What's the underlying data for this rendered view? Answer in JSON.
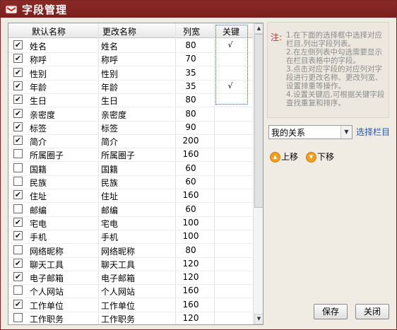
{
  "window": {
    "title": "字段管理"
  },
  "grid": {
    "columns": {
      "default_name": "默认名称",
      "new_name": "更改名称",
      "width": "列宽",
      "key": "关键"
    },
    "rows": [
      {
        "checked": true,
        "default": "姓名",
        "new": "姓名",
        "width": "80",
        "key": "√"
      },
      {
        "checked": true,
        "default": "称呼",
        "new": "称呼",
        "width": "70",
        "key": ""
      },
      {
        "checked": true,
        "default": "性别",
        "new": "性别",
        "width": "35",
        "key": ""
      },
      {
        "checked": true,
        "default": "年龄",
        "new": "年龄",
        "width": "35",
        "key": "√"
      },
      {
        "checked": true,
        "default": "生日",
        "new": "生日",
        "width": "80",
        "key": ""
      },
      {
        "checked": true,
        "default": "亲密度",
        "new": "亲密度",
        "width": "80",
        "key": ""
      },
      {
        "checked": true,
        "default": "标签",
        "new": "标签",
        "width": "90",
        "key": ""
      },
      {
        "checked": true,
        "default": "简介",
        "new": "简介",
        "width": "200",
        "key": ""
      },
      {
        "checked": false,
        "default": "所属圈子",
        "new": "所属圈子",
        "width": "160",
        "key": ""
      },
      {
        "checked": false,
        "default": "国籍",
        "new": "国籍",
        "width": "60",
        "key": ""
      },
      {
        "checked": false,
        "default": "民族",
        "new": "民族",
        "width": "60",
        "key": ""
      },
      {
        "checked": true,
        "default": "住址",
        "new": "住址",
        "width": "160",
        "key": ""
      },
      {
        "checked": false,
        "default": "邮编",
        "new": "邮编",
        "width": "60",
        "key": ""
      },
      {
        "checked": true,
        "default": "宅电",
        "new": "宅电",
        "width": "100",
        "key": ""
      },
      {
        "checked": true,
        "default": "手机",
        "new": "手机",
        "width": "100",
        "key": ""
      },
      {
        "checked": false,
        "default": "网络昵称",
        "new": "网络昵称",
        "width": "80",
        "key": ""
      },
      {
        "checked": true,
        "default": "聊天工具",
        "new": "聊天工具",
        "width": "120",
        "key": ""
      },
      {
        "checked": true,
        "default": "电子邮箱",
        "new": "电子邮箱",
        "width": "120",
        "key": ""
      },
      {
        "checked": false,
        "default": "个人网站",
        "new": "个人网站",
        "width": "160",
        "key": ""
      },
      {
        "checked": true,
        "default": "工作单位",
        "new": "工作单位",
        "width": "160",
        "key": ""
      },
      {
        "checked": false,
        "default": "工作职务",
        "new": "工作职务",
        "width": "120",
        "key": ""
      }
    ]
  },
  "note": {
    "label": "注:",
    "lines": [
      "1.在下面的选择框中选择对应栏目,列出字段列表。",
      "2.在左侧列表中勾选需要显示在栏目表格中的字段。",
      "3.点击对应字段的对应列对字段进行更改名称、更改列宽、设置排重等操作。",
      "4.设置关键后,可根据关键字段查找重复和排序。"
    ]
  },
  "category_select": {
    "value": "我的关系"
  },
  "select_column_link": "选择栏目",
  "move_up_label": "上移",
  "move_down_label": "下移",
  "save_label": "保存",
  "close_label": "关闭",
  "colors": {
    "titlebar": "#7a201d",
    "note_label": "#cc2c20",
    "link": "#1e57b3",
    "key_box": "#e0201a"
  },
  "icons": [
    "window-app-icon",
    "move-up-icon",
    "move-down-icon",
    "dropdown-arrow-icon",
    "scroll-up-icon",
    "scroll-down-icon"
  ]
}
